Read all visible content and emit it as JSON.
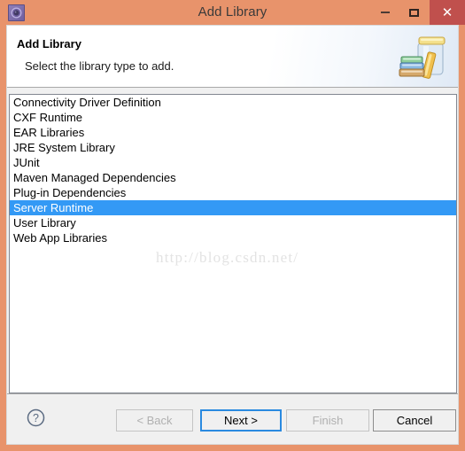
{
  "window": {
    "title": "Add Library",
    "app_icon": "gear-icon",
    "controls": {
      "minimize": "–",
      "maximize": "□",
      "close": "✕"
    },
    "frame_color": "#e8936b",
    "close_color": "#c0504d"
  },
  "header": {
    "title": "Add Library",
    "subtitle": "Select the library type to add.",
    "icon": "library-jar-books-icon"
  },
  "list": {
    "items": [
      {
        "label": "Connectivity Driver Definition",
        "selected": false
      },
      {
        "label": "CXF Runtime",
        "selected": false
      },
      {
        "label": "EAR Libraries",
        "selected": false
      },
      {
        "label": "JRE System Library",
        "selected": false
      },
      {
        "label": "JUnit",
        "selected": false
      },
      {
        "label": "Maven Managed Dependencies",
        "selected": false
      },
      {
        "label": "Plug-in Dependencies",
        "selected": false
      },
      {
        "label": "Server Runtime",
        "selected": true
      },
      {
        "label": "User Library",
        "selected": false
      },
      {
        "label": "Web App Libraries",
        "selected": false
      }
    ],
    "selection_color": "#3399f5"
  },
  "watermark": {
    "text": "http://blog.csdn.net/"
  },
  "footer": {
    "help_icon": "question-mark-icon",
    "buttons": {
      "back": "< Back",
      "next": "Next >",
      "finish": "Finish",
      "cancel": "Cancel"
    }
  }
}
